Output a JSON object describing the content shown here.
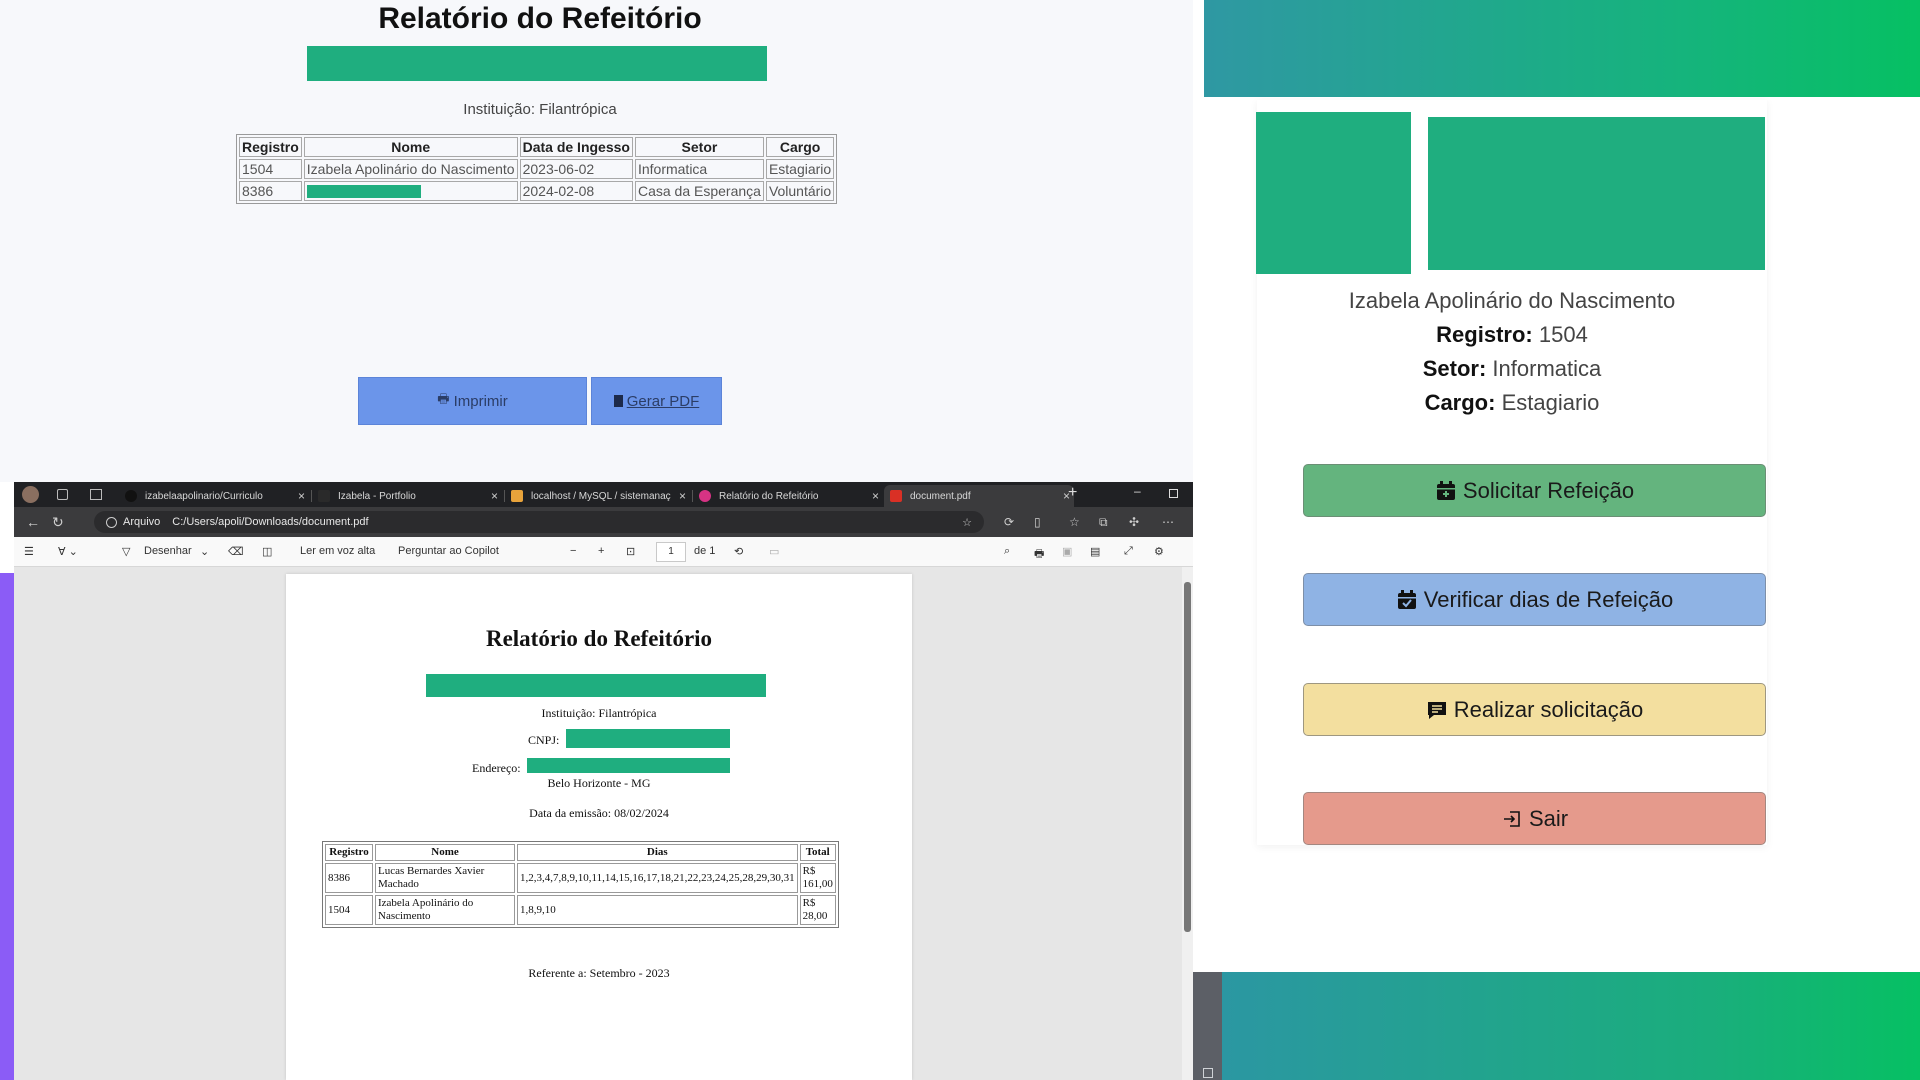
{
  "web_report": {
    "title": "Relatório do Refeitório",
    "institution": "Instituição: Filantrópica",
    "table": {
      "headers": [
        "Registro",
        "Nome",
        "Data de Ingesso",
        "Setor",
        "Cargo"
      ],
      "rows": [
        [
          "1504",
          "Izabela Apolinário do Nascimento",
          "2023-06-02",
          "Informatica",
          "Estagiario"
        ],
        [
          "8386",
          "",
          "2024-02-08",
          "Casa da Esperança",
          "Voluntário"
        ]
      ]
    },
    "print_button": "Imprimir",
    "pdf_button": "Gerar PDF"
  },
  "profile": {
    "name": "Izabela Apolinário do Nascimento",
    "registro_label": "Registro:",
    "registro_value": "1504",
    "setor_label": "Setor:",
    "setor_value": "Informatica",
    "cargo_label": "Cargo:",
    "cargo_value": "Estagiario",
    "actions": {
      "solicitar": "Solicitar Refeição",
      "verificar": "Verificar dias de Refeição",
      "realizar": "Realizar solicitação",
      "sair": "Sair"
    }
  },
  "browser": {
    "tabs": [
      {
        "label": "izabelaapolinario/Curriculo",
        "icon": "github-icon"
      },
      {
        "label": "Izabela - Portfolio",
        "icon": "portfolio-icon"
      },
      {
        "label": "localhost / MySQL / sistemanaç",
        "icon": "phpmyadmin-icon"
      },
      {
        "label": "Relatório do Refeitório",
        "icon": "page-icon"
      },
      {
        "label": "document.pdf",
        "icon": "pdf-icon"
      }
    ],
    "address_label": "Arquivo",
    "url": "C:/Users/apoli/Downloads/document.pdf",
    "pdf_toolbar": {
      "draw": "Desenhar",
      "read_aloud": "Ler em voz alta",
      "copilot": "Perguntar ao Copilot",
      "page": "1",
      "page_total": "de 1"
    }
  },
  "pdf": {
    "title": "Relatório do Refeitório",
    "institution": "Instituição: Filantrópica",
    "cnpj_label": "CNPJ:",
    "address_label": "Endereço:",
    "city": "Belo Horizonte - MG",
    "emission": "Data da emissão: 08/02/2024",
    "table": {
      "headers": [
        "Registro",
        "Nome",
        "Dias",
        "Total"
      ],
      "rows": [
        [
          "8386",
          "Lucas Bernardes Xavier Machado",
          "1,2,3,4,7,8,9,10,11,14,15,16,17,18,21,22,23,24,25,28,29,30,31",
          "R$ 161,00"
        ],
        [
          "1504",
          "Izabela Apolinário do Nascimento",
          "1,8,9,10",
          "R$ 28,00"
        ]
      ]
    },
    "reference": "Referente a: Setembro - 2023"
  },
  "colors": {
    "redaction": "#1fae7f",
    "solicitar": "#64b47e",
    "verificar": "#8fb3e4",
    "realizar": "#f3df9f",
    "sair": "#e59a8c",
    "web_button": "#6b95ea"
  }
}
